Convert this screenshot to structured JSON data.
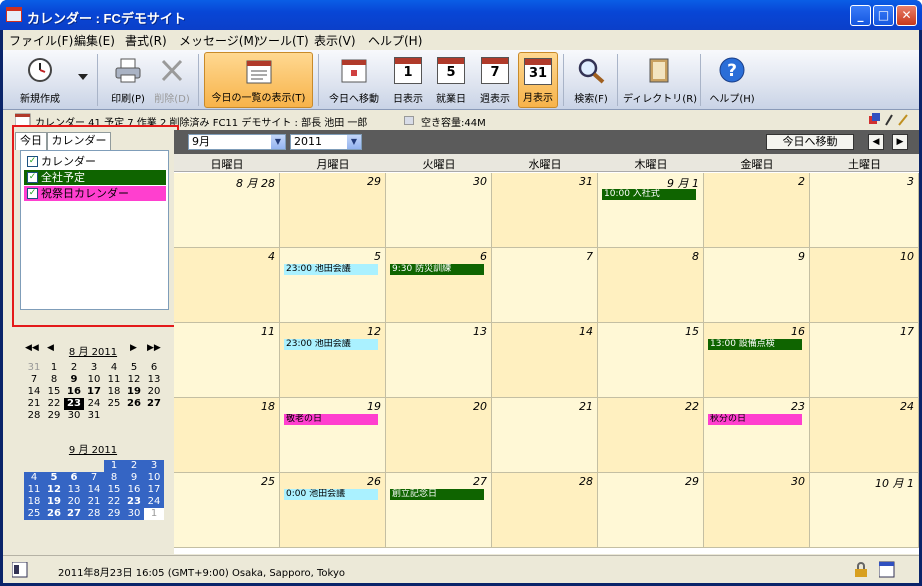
{
  "window": {
    "title": "カレンダー : FCデモサイト",
    "minimize": "_",
    "maximize": "□",
    "close": "✕"
  },
  "menu": [
    "ファイル(F)",
    "編集(E)",
    "書式(R)",
    "メッセージ(M)",
    "ツール(T)",
    "表示(V)",
    "ヘルプ(H)"
  ],
  "toolbar": {
    "new": "新規作成",
    "print": "印刷(P)",
    "delete": "削除(D)",
    "today_list": "今日の一覧の表示(T)",
    "goto_today": "今日へ移動",
    "day": "日表示",
    "workday": "就業日",
    "week": "週表示",
    "month": "月表示",
    "search": "検索(F)",
    "directory": "ディレクトリ(R)",
    "help": "ヘルプ(H)",
    "day_num": "1",
    "workday_num": "5",
    "week_num": "7",
    "month_num": "31"
  },
  "infobar": {
    "text": "カレンダー 41 予定 7 作業 2 削除済み FC11 デモサイト : 部長 池田 一郎",
    "space": "空き容量:44M"
  },
  "left_panel": {
    "tabs": [
      "今日",
      "カレンダー"
    ],
    "calendars": [
      {
        "label": "カレンダー",
        "checked": true,
        "color": "#ffffff"
      },
      {
        "label": "全社予定",
        "checked": true,
        "color": "#0f6400"
      },
      {
        "label": "祝祭日カレンダー",
        "checked": true,
        "color": "#ff3fcf"
      }
    ]
  },
  "mini_aug": {
    "title": "8 月 2011",
    "weeks": [
      [
        "31",
        "1",
        "2",
        "3",
        "4",
        "5",
        "6"
      ],
      [
        "7",
        "8",
        "9",
        "10",
        "11",
        "12",
        "13"
      ],
      [
        "14",
        "15",
        "16",
        "17",
        "18",
        "19",
        "20"
      ],
      [
        "21",
        "22",
        "23",
        "24",
        "25",
        "26",
        "27"
      ],
      [
        "28",
        "29",
        "30",
        "31",
        "",
        "",
        ""
      ]
    ]
  },
  "mini_sep": {
    "title": "9 月 2011",
    "weeks": [
      [
        "",
        "",
        "",
        "",
        "1",
        "2",
        "3"
      ],
      [
        "4",
        "5",
        "6",
        "7",
        "8",
        "9",
        "10"
      ],
      [
        "11",
        "12",
        "13",
        "14",
        "15",
        "16",
        "17"
      ],
      [
        "18",
        "19",
        "20",
        "21",
        "22",
        "23",
        "24"
      ],
      [
        "25",
        "26",
        "27",
        "28",
        "29",
        "30",
        "1"
      ]
    ]
  },
  "header": {
    "month": "9月",
    "year": "2011",
    "goto_today": "今日へ移動"
  },
  "days_of_week": [
    "日曜日",
    "月曜日",
    "火曜日",
    "水曜日",
    "木曜日",
    "金曜日",
    "土曜日"
  ],
  "weeks": [
    [
      {
        "d": "8 月 28"
      },
      {
        "d": "29"
      },
      {
        "d": "30"
      },
      {
        "d": "31"
      },
      {
        "d": "9 月 1",
        "ev": [
          {
            "t": "10:00 入社式",
            "c": "green"
          }
        ]
      },
      {
        "d": "2"
      },
      {
        "d": "3"
      }
    ],
    [
      {
        "d": "4"
      },
      {
        "d": "5",
        "ev": [
          {
            "t": "23:00 池田会議",
            "c": "cyan"
          }
        ]
      },
      {
        "d": "6",
        "ev": [
          {
            "t": "9:30 防災訓練",
            "c": "green"
          }
        ]
      },
      {
        "d": "7"
      },
      {
        "d": "8"
      },
      {
        "d": "9"
      },
      {
        "d": "10"
      }
    ],
    [
      {
        "d": "11"
      },
      {
        "d": "12",
        "ev": [
          {
            "t": "23:00 池田会議",
            "c": "cyan"
          }
        ]
      },
      {
        "d": "13"
      },
      {
        "d": "14"
      },
      {
        "d": "15"
      },
      {
        "d": "16",
        "ev": [
          {
            "t": "13:00 設備点検",
            "c": "green"
          }
        ]
      },
      {
        "d": "17"
      }
    ],
    [
      {
        "d": "18"
      },
      {
        "d": "19",
        "ev": [
          {
            "t": "敬老の日",
            "c": "pink"
          }
        ]
      },
      {
        "d": "20"
      },
      {
        "d": "21"
      },
      {
        "d": "22"
      },
      {
        "d": "23",
        "ev": [
          {
            "t": "秋分の日",
            "c": "pink"
          }
        ]
      },
      {
        "d": "24"
      }
    ],
    [
      {
        "d": "25"
      },
      {
        "d": "26",
        "ev": [
          {
            "t": "0:00 池田会議",
            "c": "cyan"
          }
        ]
      },
      {
        "d": "27",
        "ev": [
          {
            "t": "創立記念日",
            "c": "green"
          }
        ]
      },
      {
        "d": "28"
      },
      {
        "d": "29"
      },
      {
        "d": "30"
      },
      {
        "d": "10 月 1"
      }
    ]
  ],
  "status": {
    "text": "2011年8月23日 16:05 (GMT+9:00) Osaka, Sapporo, Tokyo"
  }
}
